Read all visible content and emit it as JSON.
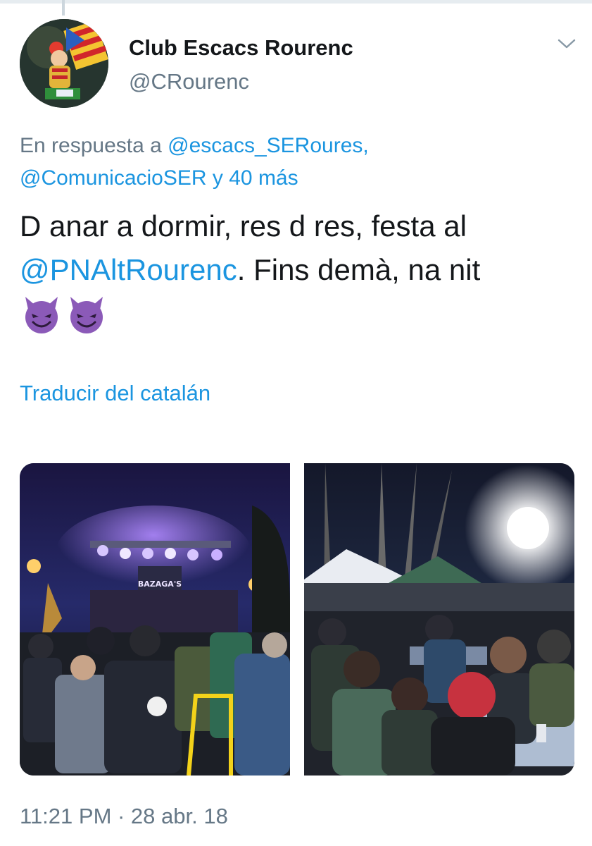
{
  "tweet": {
    "display_name": "Club Escacs Rourenc",
    "handle": "@CRourenc",
    "reply": {
      "prefix": "En respuesta a",
      "mention_1": "@escacs_SERoures,",
      "mention_2": "@ComunicacioSER",
      "joiner": "y",
      "others": "40 más"
    },
    "text": {
      "part_1": "D anar a dormir, res d res, festa al",
      "mention": "@PNAltRourenc",
      "part_2": ". Fins demà, na nit"
    },
    "emoji": [
      "smiling-imp-emoji",
      "smiling-imp-emoji"
    ],
    "translate_label": "Traducir del catalán",
    "media": [
      {
        "name": "concert-stage-photo",
        "banner_text": "BAZAGA'S"
      },
      {
        "name": "outdoor-dinner-photo"
      }
    ],
    "timestamp": "11:21 PM · 28 abr. 18"
  },
  "colors": {
    "link": "#1b95e0",
    "secondary_text": "#657786",
    "primary_text": "#14171a",
    "emoji_purple": "#8b5ab8"
  },
  "icons": {
    "menu": "chevron-down-icon"
  }
}
